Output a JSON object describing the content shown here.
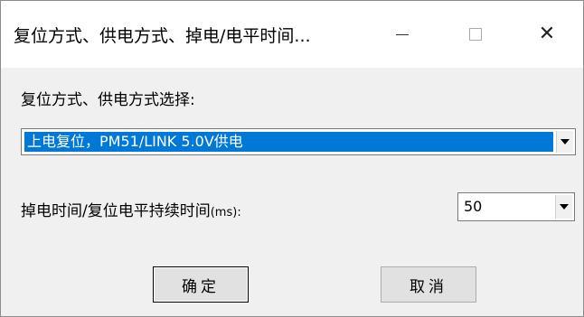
{
  "window": {
    "title": "复位方式、供电方式、掉电/电平时间...",
    "controls": {
      "minimize_icon": "minimize-icon",
      "maximize_icon": "maximize-icon",
      "close_icon": "close-icon",
      "close_glyph": "✕"
    }
  },
  "reset_section": {
    "label": "复位方式、供电方式选择:",
    "selected_value": "上电复位，PM51/LINK 5.0V供电",
    "highlight_color": "#0078d7"
  },
  "time_section": {
    "label": "掉电时间/复位电平持续时间",
    "unit": "(ms):",
    "selected_value": "50"
  },
  "buttons": {
    "ok_label": "确定",
    "cancel_label": "取消"
  }
}
